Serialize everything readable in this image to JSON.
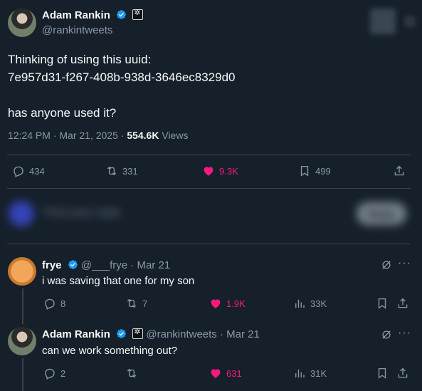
{
  "main_tweet": {
    "author_name": "Adam Rankin",
    "author_handle": "@rankintweets",
    "text_line1": "Thinking of using this uuid:",
    "text_line2": "7e957d31-f267-408b-938d-3646ec8329d0",
    "text_line3": "has anyone used it?",
    "timestamp": "12:24 PM · Mar 21, 2025 · ",
    "views_count": "554.6K",
    "views_label": " Views",
    "actions": {
      "replies": "434",
      "reposts": "331",
      "likes": "9.3K",
      "bookmarks": "499"
    }
  },
  "reply_composer": {
    "placeholder": "Post your reply",
    "button": "Reply"
  },
  "replies": [
    {
      "author_name": "frye",
      "author_handle": "@___frye",
      "date": " · Mar 21",
      "text": "i was saving that one for my son",
      "actions": {
        "replies": "8",
        "reposts": "7",
        "likes": "1.9K",
        "views": "33K"
      }
    },
    {
      "author_name": "Adam Rankin",
      "author_handle": "@rankintweets",
      "date": " · Mar 21",
      "text": "can we work something out?",
      "actions": {
        "replies": "2",
        "reposts": "",
        "likes": "631",
        "views": "31K"
      }
    }
  ],
  "colors": {
    "background": "#15202b",
    "like_pink": "#f91880",
    "verified_blue": "#1d9bf0",
    "muted": "#8b98a5"
  }
}
